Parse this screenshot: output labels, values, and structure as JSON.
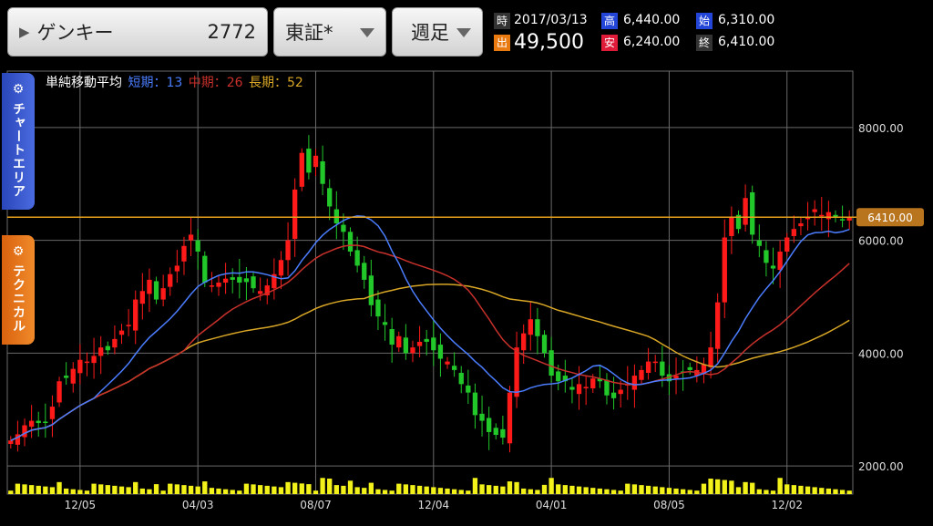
{
  "header": {
    "stock_name": "ゲンキー",
    "stock_code": "2772",
    "market": "東証*",
    "period": "週足"
  },
  "quote": {
    "time_label": "時",
    "date": "2017/03/13",
    "volume_label": "出",
    "volume": "49,500",
    "high_label": "高",
    "high": "6,440.00",
    "low_label": "安",
    "low": "6,240.00",
    "open_label": "始",
    "open": "6,310.00",
    "close_label": "終",
    "close": "6,410.00"
  },
  "tabs": {
    "chart_area": "チャートエリア",
    "technical": "テクニカル"
  },
  "legend": {
    "title": "単純移動平均",
    "short": "短期：13",
    "mid": "中期：26",
    "long": "長期：52"
  },
  "colors": {
    "up": "#ff1a1a",
    "down": "#22c72a",
    "short_ma": "#4a7dff",
    "mid_ma": "#c8312b",
    "long_ma": "#d8a626",
    "volume": "#f2f21a",
    "current_line": "#e6a11a",
    "grid": "#6a6a6a"
  },
  "chart_data": {
    "type": "candlestick",
    "ylim": [
      1500,
      9000
    ],
    "y_ticks": [
      "8000.00",
      "6000.00",
      "4000.00",
      "2000.00"
    ],
    "y_tick_values": [
      8000,
      6000,
      4000,
      2000
    ],
    "x_labels": [
      "12/05",
      "04/03",
      "08/07",
      "12/04",
      "04/01",
      "08/05",
      "12/02"
    ],
    "x_label_indices": [
      10,
      27,
      44,
      61,
      78,
      95,
      112
    ],
    "current_price": 6410,
    "current_price_label": "6410.00",
    "closes": [
      2450,
      2560,
      2720,
      2800,
      2760,
      2780,
      3050,
      3500,
      3560,
      3720,
      3880,
      3850,
      3950,
      4100,
      4050,
      4250,
      4400,
      4500,
      4950,
      5100,
      5300,
      4950,
      5150,
      5400,
      5550,
      5900,
      6100,
      5800,
      5250,
      5200,
      5250,
      5320,
      5300,
      5250,
      5260,
      5150,
      5100,
      5200,
      5400,
      5650,
      6000,
      6900,
      7550,
      7200,
      7500,
      7000,
      6600,
      6300,
      6150,
      5800,
      5550,
      5300,
      4850,
      4650,
      4500,
      4150,
      4300,
      4000,
      4100,
      4200,
      4200,
      4050,
      3900,
      3850,
      3700,
      3450,
      3300,
      2900,
      2800,
      2600,
      2550,
      2500,
      3300,
      4100,
      4350,
      4600,
      4300,
      4000,
      3600,
      3500,
      3500,
      3350,
      3450,
      3400,
      3550,
      3500,
      3250,
      3200,
      3350,
      3450,
      3600,
      3700,
      3850,
      3850,
      3600,
      3500,
      3600,
      3650,
      3700,
      3700,
      3800,
      4100,
      4900,
      6050,
      6400,
      6200,
      6750,
      6100,
      5900,
      5600,
      5500,
      5800,
      6050,
      6200,
      6300,
      6400,
      6550,
      6450,
      6500,
      6400,
      6350,
      6410
    ],
    "volume_max": 30000
  }
}
